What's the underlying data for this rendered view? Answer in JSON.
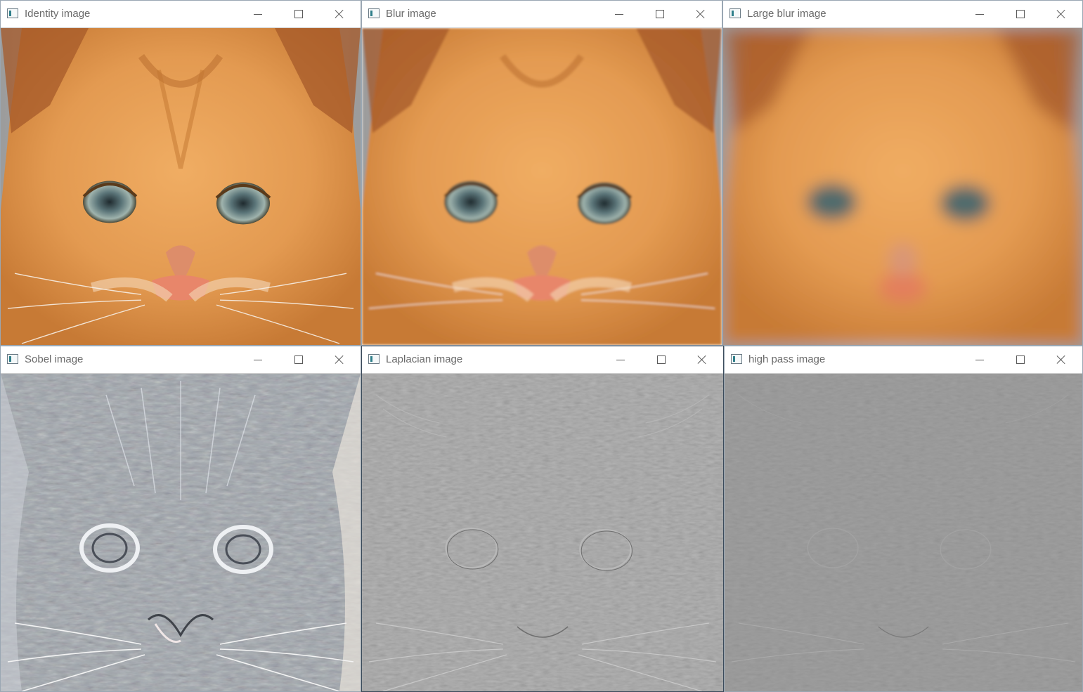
{
  "windows": [
    {
      "id": "identity",
      "title": "Identity image"
    },
    {
      "id": "blur",
      "title": "Blur image"
    },
    {
      "id": "large-blur",
      "title": "Large blur image"
    },
    {
      "id": "sobel",
      "title": "Sobel image"
    },
    {
      "id": "laplacian",
      "title": "Laplacian image"
    },
    {
      "id": "high-pass",
      "title": "high pass image"
    }
  ],
  "icons": {
    "app": "opencv-window-icon",
    "minimize": "minimize-icon",
    "maximize": "maximize-icon",
    "close": "close-icon"
  },
  "colors": {
    "kitten_fur": "#e49b52",
    "kitten_shadow": "#c97a36",
    "background_gray": "#a9a9a9",
    "filter_gray": "#8f8f8f",
    "sobel_gray": "#9ea4ab"
  }
}
